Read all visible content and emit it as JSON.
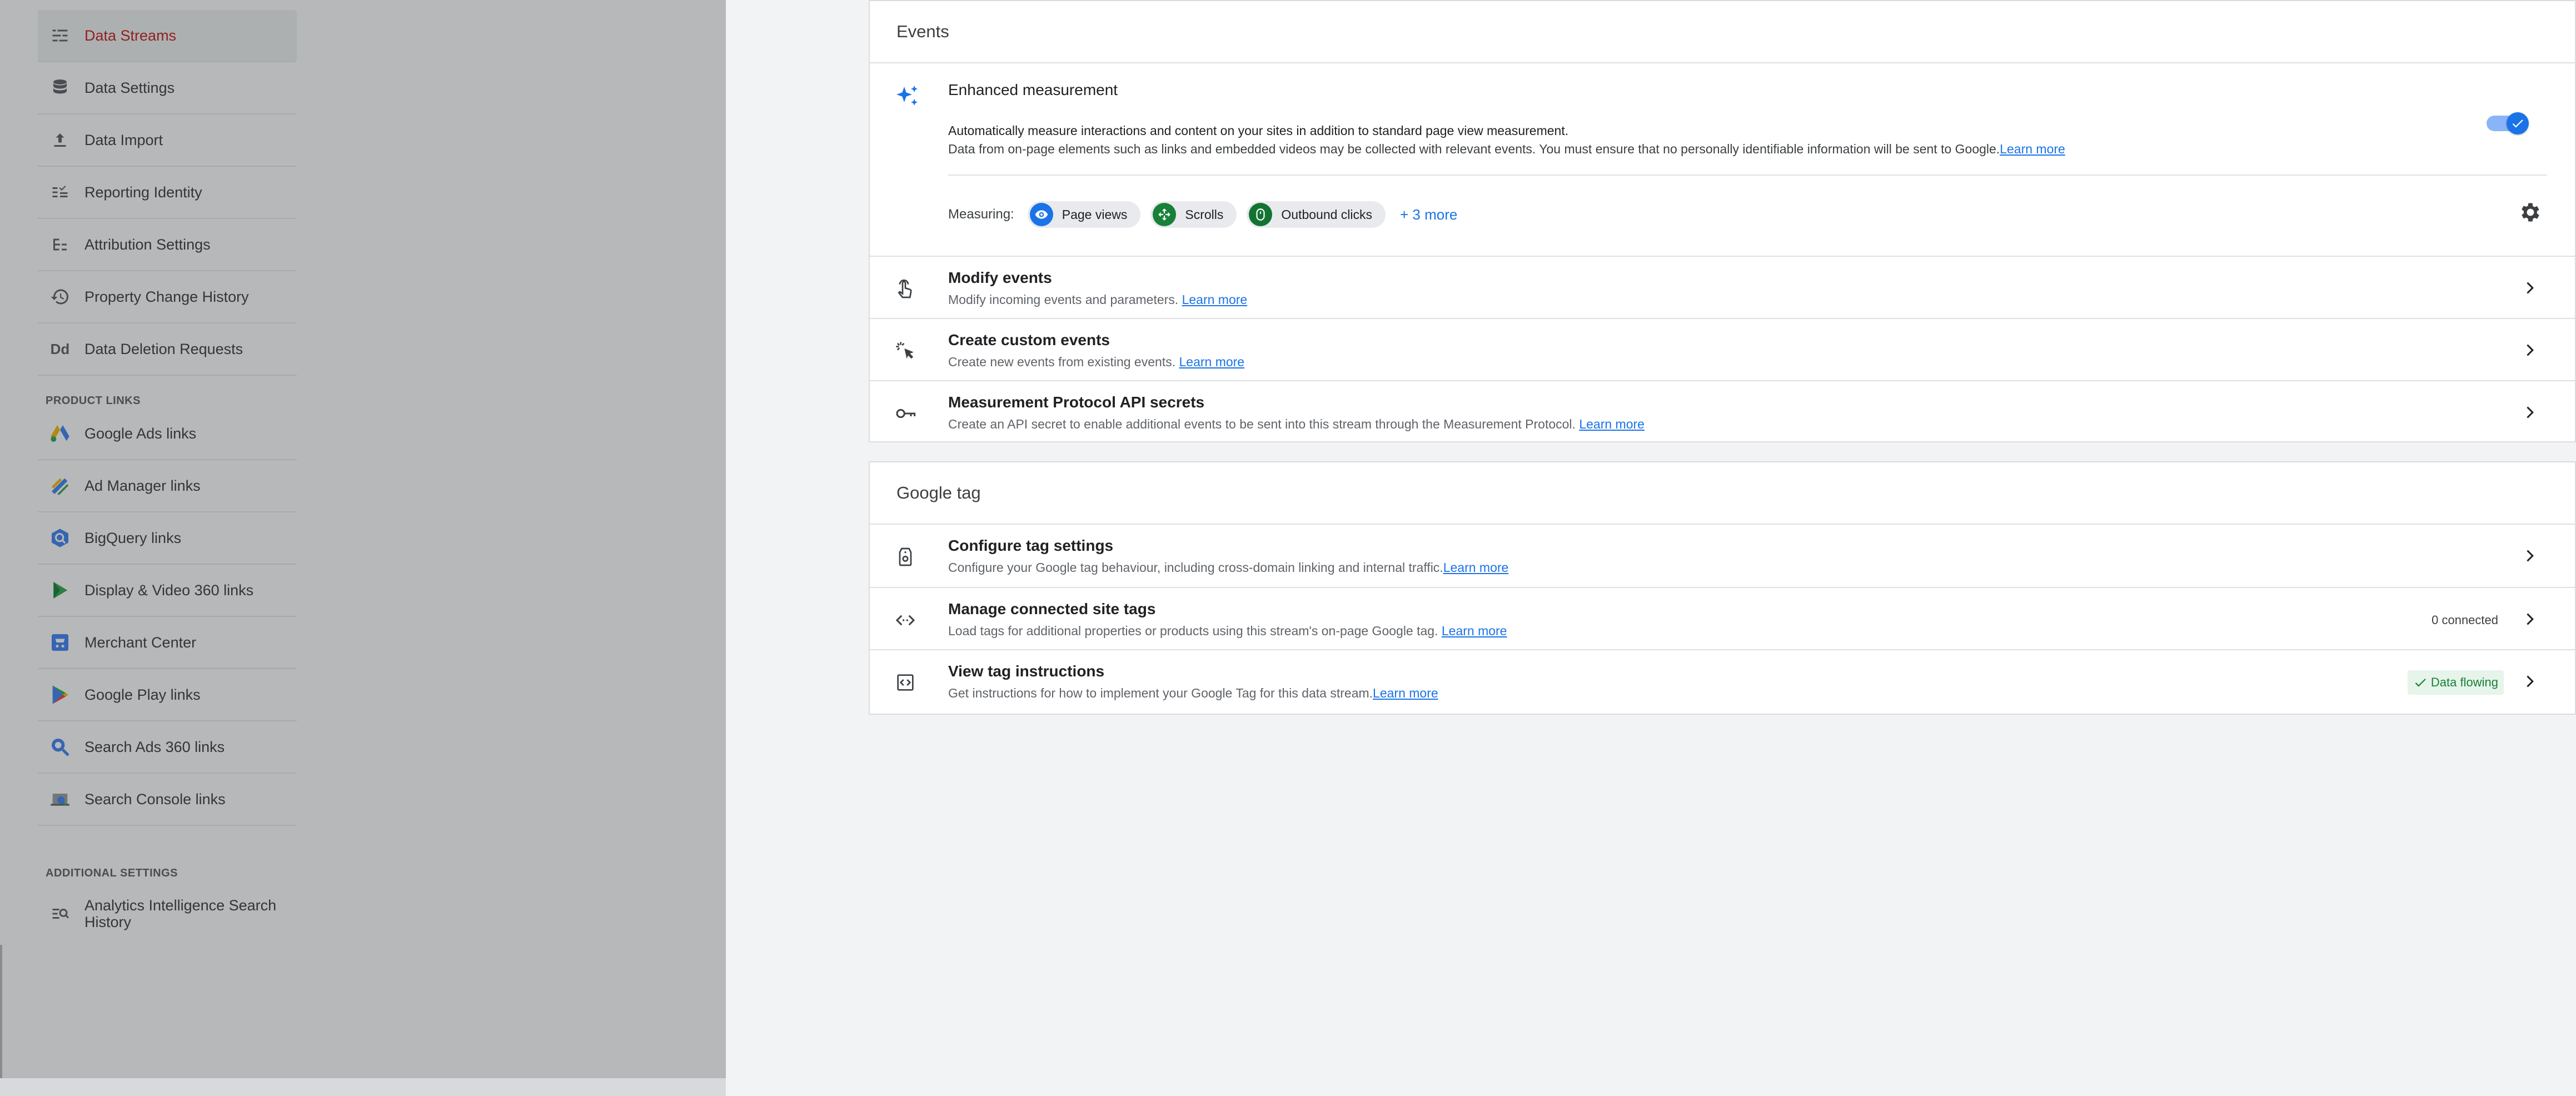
{
  "sidebar": {
    "items": [
      {
        "label": "Data Streams",
        "icon": "data-streams-icon",
        "active": true
      },
      {
        "label": "Data Settings",
        "icon": "database-icon"
      },
      {
        "label": "Data Import",
        "icon": "upload-icon"
      },
      {
        "label": "Reporting Identity",
        "icon": "reporting-identity-icon"
      },
      {
        "label": "Attribution Settings",
        "icon": "attribution-icon"
      },
      {
        "label": "Property Change History",
        "icon": "history-icon"
      },
      {
        "label": "Data Deletion Requests",
        "icon": "dd-icon",
        "icon_text": "Dd"
      }
    ],
    "product_links_heading": "PRODUCT LINKS",
    "product_links": [
      {
        "label": "Google Ads links",
        "icon": "google-ads-icon"
      },
      {
        "label": "Ad Manager links",
        "icon": "ad-manager-icon"
      },
      {
        "label": "BigQuery links",
        "icon": "bigquery-icon"
      },
      {
        "label": "Display & Video 360 links",
        "icon": "dv360-icon"
      },
      {
        "label": "Merchant Center",
        "icon": "merchant-center-icon"
      },
      {
        "label": "Google Play links",
        "icon": "google-play-icon"
      },
      {
        "label": "Search Ads 360 links",
        "icon": "search-ads-icon"
      },
      {
        "label": "Search Console links",
        "icon": "search-console-icon"
      }
    ],
    "additional_heading": "ADDITIONAL SETTINGS",
    "additional": [
      {
        "label_line1": "Analytics Intelligence Search",
        "label_line2": "History",
        "icon": "search-history-icon"
      }
    ]
  },
  "events": {
    "title": "Events",
    "enhanced": {
      "title": "Enhanced measurement",
      "desc1": "Automatically measure interactions and content on your sites in addition to standard page view measurement.",
      "desc2": "Data from on-page elements such as links and embedded videos may be collected with relevant events. You must ensure that no personally identifiable information will be sent to Google.",
      "learn_more": "Learn more",
      "enabled": true,
      "measuring_label": "Measuring:",
      "chips": [
        {
          "label": "Page views",
          "icon": "eye-icon",
          "color": "#1a73e8"
        },
        {
          "label": "Scrolls",
          "icon": "scroll-icon",
          "color": "#188038"
        },
        {
          "label": "Outbound clicks",
          "icon": "mouse-icon",
          "color": "#137333"
        }
      ],
      "more": "+ 3 more"
    },
    "rows": [
      {
        "title": "Modify events",
        "desc": "Modify incoming events and parameters.",
        "link": "Learn more",
        "icon": "touch-icon"
      },
      {
        "title": "Create custom events",
        "desc": "Create new events from existing events.",
        "link": "Learn more",
        "icon": "sparkle-click-icon"
      },
      {
        "title": "Measurement Protocol API secrets",
        "desc": "Create an API secret to enable additional events to be sent into this stream through the Measurement Protocol.",
        "link": "Learn more",
        "icon": "key-icon"
      }
    ]
  },
  "google_tag": {
    "title": "Google tag",
    "rows": [
      {
        "title": "Configure tag settings",
        "desc": "Configure your Google tag behaviour, including cross-domain linking and internal traffic.",
        "link": "Learn more",
        "icon": "tag-settings-icon"
      },
      {
        "title": "Manage connected site tags",
        "desc": "Load tags for additional properties or products using this stream's on-page Google tag.",
        "link": "Learn more",
        "icon": "code-icon",
        "badge": "0 connected"
      },
      {
        "title": "View tag instructions",
        "desc": "Get instructions for how to implement your Google Tag for this data stream.",
        "link": "Learn more",
        "icon": "tag-code-icon",
        "badge": "Data flowing",
        "badge_status": "success"
      }
    ]
  },
  "colors": {
    "accent": "#1a73e8",
    "active_nav": "#c5221f",
    "success": "#188038"
  }
}
